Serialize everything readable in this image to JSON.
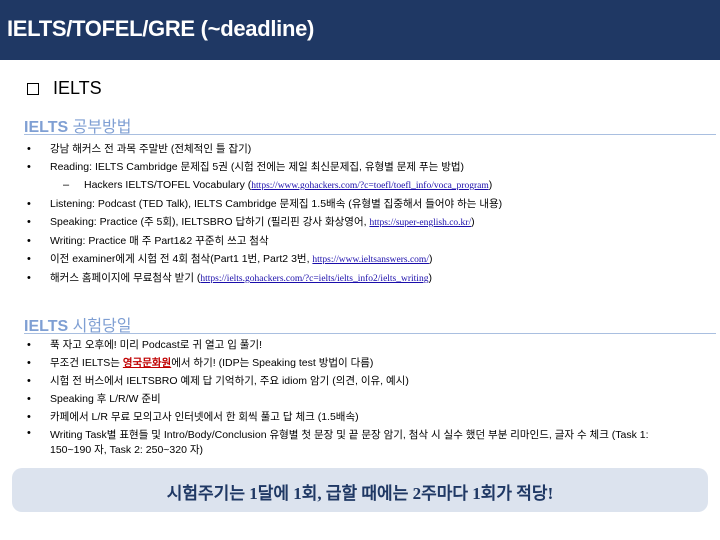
{
  "title": "IELTS/TOFEL/GRE (~deadline)",
  "section_label": "IELTS",
  "study": {
    "heading_en": "IELTS",
    "heading_kr": "공부방법",
    "items": [
      {
        "text": "강남 해커스 전 과목 주말반 (전체적인 틀 잡기)"
      },
      {
        "text": "Reading: IELTS Cambridge 문제집 5권 (시험 전에는 제일 최신문제집, 유형별 문제 푸는 방법)"
      },
      {
        "sub_pre": "Hackers IELTS/TOFEL Vocabulary (",
        "sub_link": "https://www.gohackers.com/?c=toefl/toefl_info/voca_program",
        "sub_post": ")"
      },
      {
        "text": "Listening: Podcast (TED Talk), IELTS Cambridge 문제집 1.5배속 (유형별 집중해서 들어야 하는 내용)"
      },
      {
        "pre": "Speaking: Practice (주 5회), IELTSBRO 답하기 (필리핀 강사 화상영어, ",
        "link": "https://super-english.co.kr/",
        "post": ")"
      },
      {
        "text": "Writing: Practice 매 주 Part1&2 꾸준히 쓰고 첨삭"
      },
      {
        "pre": "이전 examiner에게 시험 전 4회 첨삭(Part1 1번, Part2 3번, ",
        "link": "https://www.ieltsanswers.com/",
        "post": ")"
      },
      {
        "pre": "해커스 홈페이지에 무료첨삭 받기 (",
        "link": "https://ielts.gohackers.com/?c=ielts/ielts_info2/ielts_writing",
        "post": ")"
      }
    ]
  },
  "exam_day": {
    "heading_en": "IELTS",
    "heading_kr": "시험당일",
    "items": [
      {
        "text": "푹 자고 오후에! 미리 Podcast로 귀 열고 입 풀기!"
      },
      {
        "pre": "무조건 IELTS는 ",
        "highlight": "영국문화원",
        "post": "에서 하기! (IDP는 Speaking test 방법이 다름)"
      },
      {
        "text": "시험 전 버스에서 IELTSBRO 예제 답 기억하기, 주요 idiom 암기 (의견, 이유, 예시)"
      },
      {
        "text": "Speaking 후 L/R/W 준비"
      },
      {
        "text": "카페에서 L/R 무료 모의고사 인터넷에서 한 회씩 풀고 답 체크 (1.5배속)"
      },
      {
        "text": "Writing Task별 표현들 및 Intro/Body/Conclusion 유형별 첫 문장 및 끝 문장 암기, 첨삭 시 실수 했던 부분 리마인드, 글자 수 체크 (Task 1: 150~190 자, Task 2: 250~320 자)"
      }
    ]
  },
  "footer": "시험주기는 1달에 1회, 급할 때에는 2주마다 1회가 적당!",
  "colors": {
    "title_bar": "#1f3864",
    "subheading": "#7f9fd3",
    "footer_bg": "#dce3ee",
    "highlight": "#c00000"
  }
}
